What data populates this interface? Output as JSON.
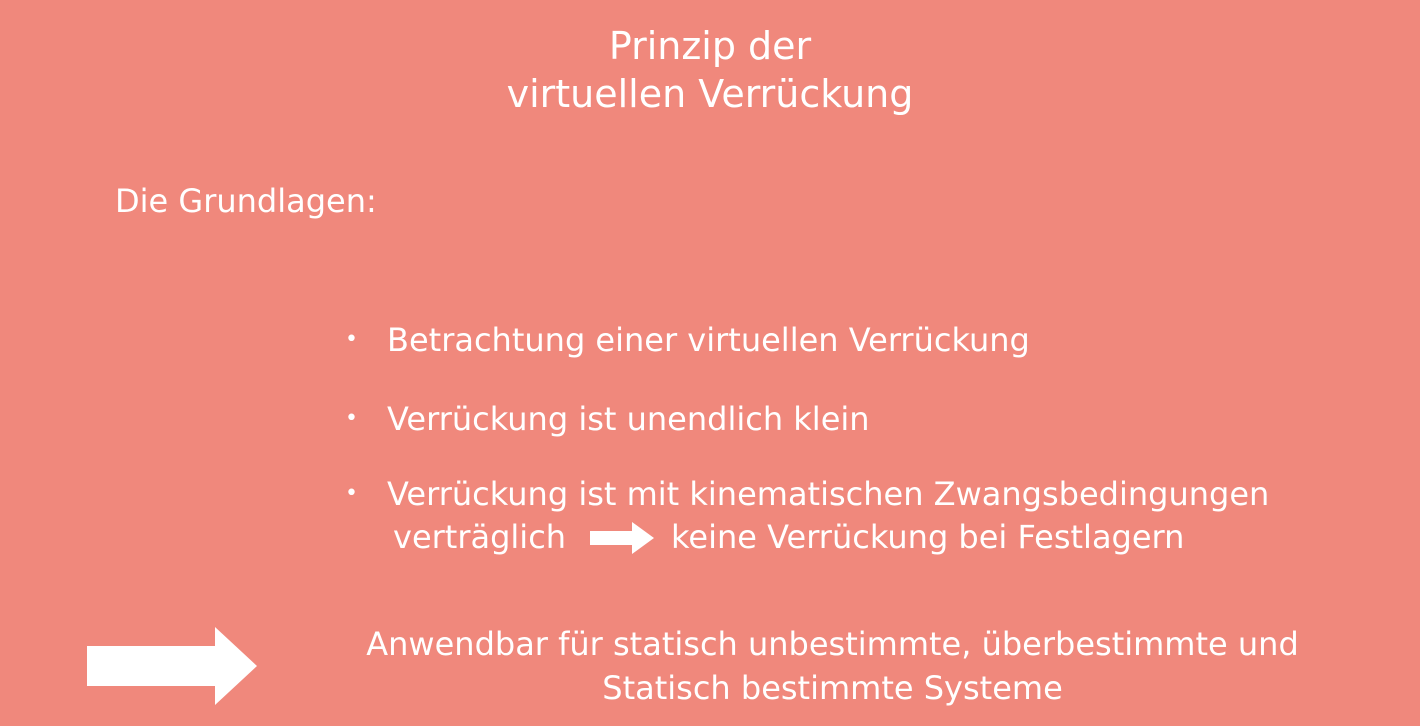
{
  "slide": {
    "title_line1": "Prinzip der",
    "title_line2": "virtuellen Verrückung",
    "subtitle": "Die Grundlagen:",
    "bullet_symbol": "•",
    "bullets": [
      "Betrachtung einer virtuellen Verrückung",
      "Verrückung ist unendlich klein",
      "Verrückung ist mit kinematischen Zwangsbedingungen"
    ],
    "bullet3_continuation_left": "verträglich",
    "bullet3_continuation_right": "keine Verrückung bei Festlagern",
    "conclusion_line1": "Anwendbar für statisch unbestimmte, überbestimmte und",
    "conclusion_line2": "Statisch bestimmte Systeme"
  },
  "colors": {
    "background": "#f0887c",
    "text": "#ffffff",
    "arrow": "#ffffff"
  },
  "icons": {
    "small_arrow": "right-arrow-icon",
    "big_arrow": "right-arrow-icon"
  }
}
